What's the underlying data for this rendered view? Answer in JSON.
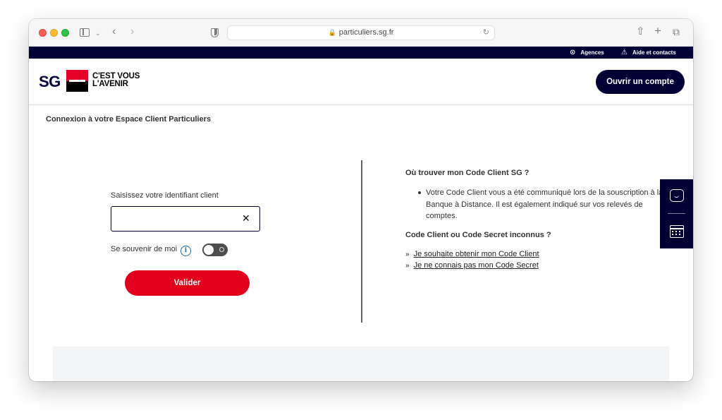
{
  "browser": {
    "url": "particuliers.sg.fr",
    "icons": [
      "sidebar-icon",
      "chevron-down-icon",
      "back-icon",
      "forward-icon",
      "shield-icon",
      "lock-icon",
      "reload-icon",
      "share-icon",
      "new-tab-icon",
      "tabs-overview-icon"
    ]
  },
  "utility_bar": {
    "agencies": "Agences",
    "help": "Aide et contacts"
  },
  "header": {
    "logo_text": "SG",
    "tagline_line1": "C'EST VOUS",
    "tagline_line2": "L'AVENIR",
    "open_account": "Ouvrir un compte"
  },
  "colors": {
    "navy": "#010035",
    "red": "#e2001a"
  },
  "login": {
    "breadcrumb": "Connexion à votre Espace Client Particuliers",
    "field_label": "Saisissez votre identifiant client",
    "field_value": "",
    "clear": "✕",
    "remember_label": "Se souvenir de moi",
    "info": "i",
    "remember_enabled": false,
    "submit": "Valider"
  },
  "help": {
    "title": "Où trouver mon Code Client SG ?",
    "bullet": "Votre Code Client vous a été communiqué lors de la souscription à la Banque à Distance. Il est également indiqué sur vos relevés de comptes.",
    "title2": "Code Client ou Code Secret inconnus ?",
    "link1": "Je souhaite obtenir mon Code Client",
    "link2": "Je ne connais pas mon Code Secret",
    "chevron": "»"
  }
}
